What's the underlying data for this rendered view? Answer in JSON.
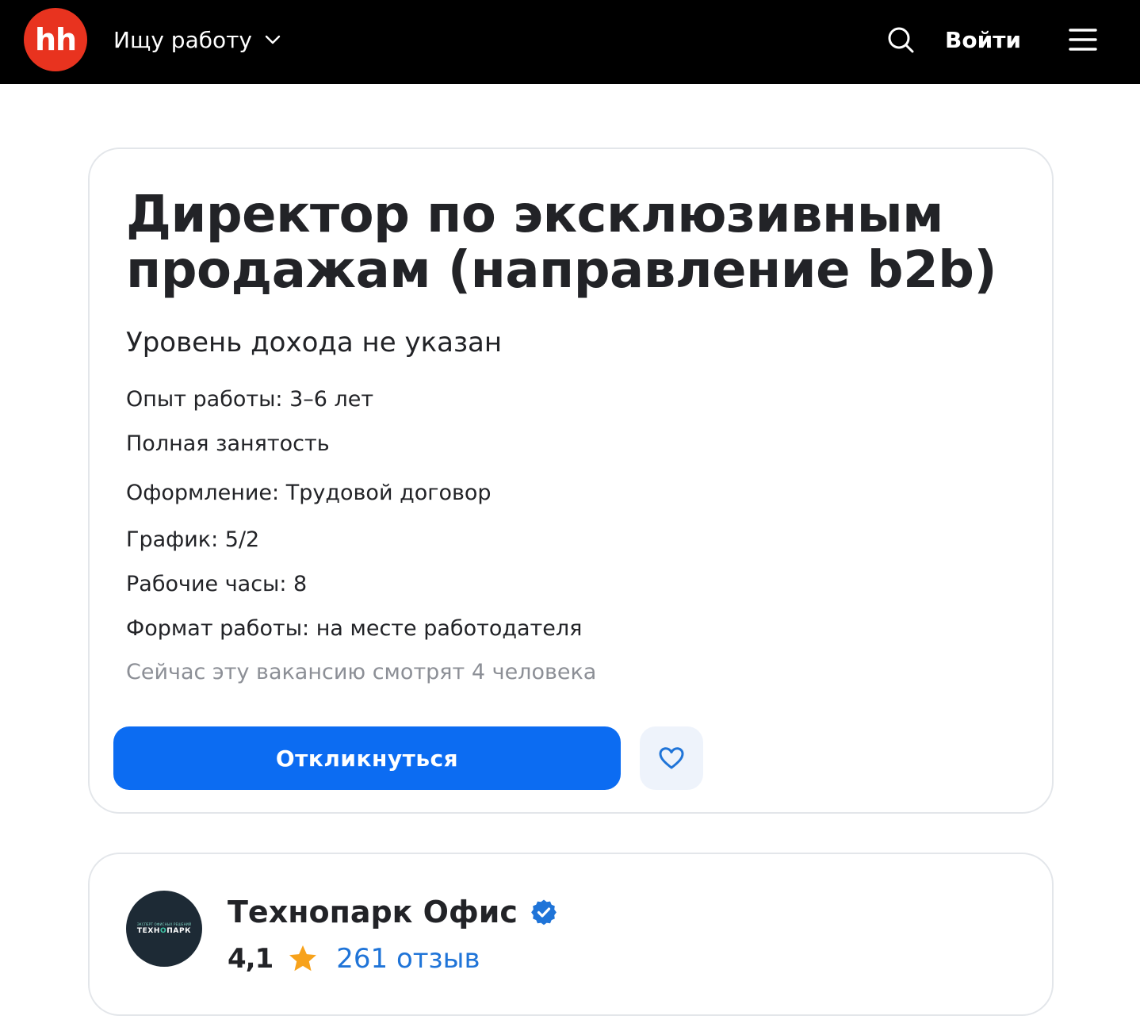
{
  "header": {
    "logo_text": "hh",
    "role_label": "Ищу работу",
    "search_icon": "search-icon",
    "login_label": "Войти",
    "menu_icon": "hamburger-menu-icon",
    "colors": {
      "background": "#000000",
      "logo": "#e8331f"
    }
  },
  "vacancy": {
    "title": "Директор по эксклюзивным продажам (направление b2b)",
    "salary": "Уровень дохода не указан",
    "details": [
      "Опыт работы: 3–6 лет",
      "Полная занятость",
      "Оформление: Трудовой договор",
      "График: 5/2",
      "Рабочие часы: 8",
      "Формат работы: на месте работодателя"
    ],
    "viewers": "Сейчас эту вакансию смотрят 4 человека",
    "apply_label": "Откликнуться",
    "favorite_icon": "heart-icon",
    "colors": {
      "apply": "#0c6cf2",
      "favorite_bg": "#eef3fb"
    }
  },
  "employer": {
    "logo_small_text": "ЭКСПЕРТ ОФИСНЫХ РЕШЕНИЙ",
    "logo_brand_left": "ТЕХН",
    "logo_brand_accent": "О",
    "logo_brand_right": "ПАРК",
    "name": "Технопарк Офис",
    "verified_icon": "verified-badge-icon",
    "rating": "4,1",
    "star_icon": "star-icon",
    "reviews": "261 отзыв",
    "colors": {
      "verified": "#1f74d8",
      "star": "#f7a21b",
      "reviews_link": "#1f74d8"
    }
  }
}
